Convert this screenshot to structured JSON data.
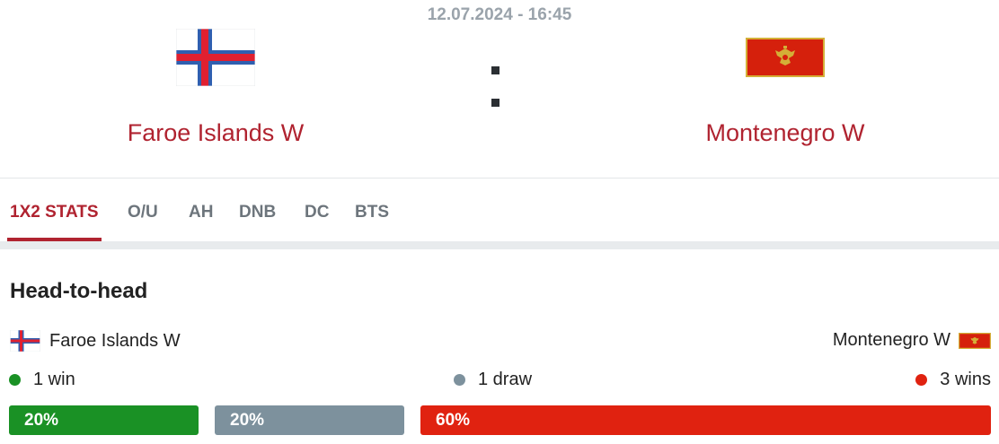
{
  "match": {
    "datetime": "12.07.2024 - 16:45",
    "home": {
      "name": "Faroe Islands W",
      "flag": "faroe-islands-flag"
    },
    "away": {
      "name": "Montenegro W",
      "flag": "montenegro-flag"
    }
  },
  "tabs": [
    {
      "label": "1X2 STATS",
      "active": true
    },
    {
      "label": "O/U"
    },
    {
      "label": "AH"
    },
    {
      "label": "DNB"
    },
    {
      "label": "DC"
    },
    {
      "label": "BTS"
    }
  ],
  "h2h": {
    "title": "Head-to-head",
    "home_team": "Faroe Islands W",
    "away_team": "Montenegro W",
    "home_result": "1 win",
    "draw_result": "1 draw",
    "away_result": "3 wins",
    "home_pct_label": "20%",
    "draw_pct_label": "20%",
    "away_pct_label": "60%",
    "home_share": 0.2,
    "draw_share": 0.2,
    "away_share": 0.6
  },
  "colors": {
    "accent": "#b02330",
    "win": "#1a9125",
    "draw": "#7d919d",
    "loss": "#e02210"
  }
}
